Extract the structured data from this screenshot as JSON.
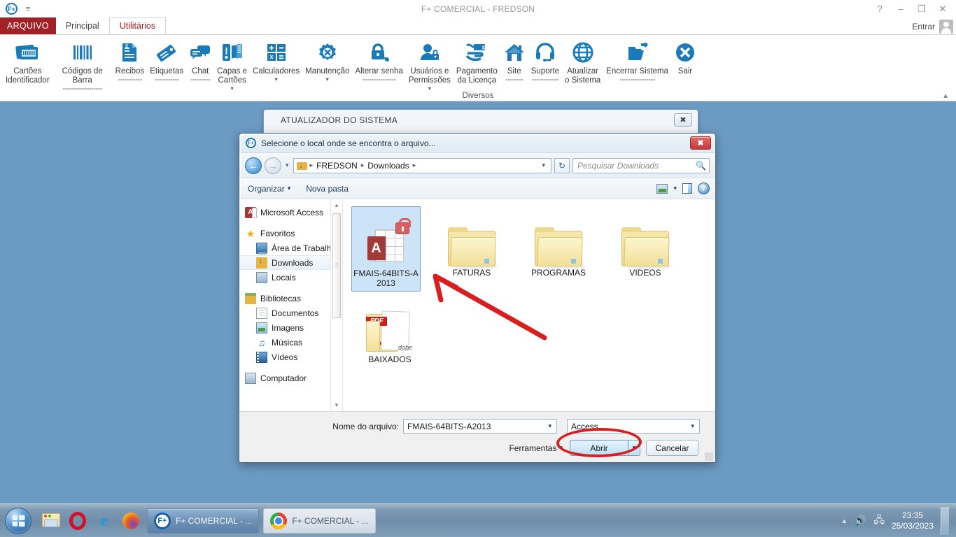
{
  "app": {
    "title": "F+ COMERCIAL - FREDSON",
    "logo": "F+",
    "quick_access_more": "≡",
    "window_controls": [
      {
        "name": "help",
        "glyph": "?"
      },
      {
        "name": "minimize",
        "glyph": "–"
      },
      {
        "name": "restore",
        "glyph": "❐"
      },
      {
        "name": "close",
        "glyph": "✕"
      }
    ],
    "signin_label": "Entrar"
  },
  "tabs": {
    "file_tab": "ARQUIVO",
    "items": [
      {
        "label": "Principal",
        "active": false
      },
      {
        "label": "Utilitários",
        "active": true
      }
    ]
  },
  "ribbon": {
    "group_name": "Diversos",
    "collapse_glyph": "▲",
    "buttons": [
      {
        "label": "Cartões\nIdentificador",
        "icon": "id-card-icon",
        "dash": "",
        "caret": false
      },
      {
        "label": "Códigos de Barra",
        "icon": "barcode-icon",
        "dash": "------------------",
        "caret": false
      },
      {
        "label": "Recibos",
        "icon": "receipt-icon",
        "dash": "-----------",
        "caret": false
      },
      {
        "label": "Etiquetas",
        "icon": "tag-icon",
        "dash": "-----------",
        "caret": false
      },
      {
        "label": "Chat",
        "icon": "chat-icon",
        "dash": "---------",
        "caret": false
      },
      {
        "label": "Capas e\nCartões",
        "icon": "card-cover-icon",
        "dash": "",
        "caret": true
      },
      {
        "label": "Calculadores",
        "icon": "calculator-icon",
        "dash": "",
        "caret": true
      },
      {
        "label": "Manutenção",
        "icon": "maintenance-gear-icon",
        "dash": "",
        "caret": true
      },
      {
        "label": "Alterar senha",
        "icon": "lock-key-icon",
        "dash": "---------------",
        "caret": false
      },
      {
        "label": "Usuários e\nPermissões",
        "icon": "user-lock-icon",
        "dash": "",
        "caret": true
      },
      {
        "label": "Pagamento\nda Licença",
        "icon": "money-hand-icon",
        "dash": "",
        "caret": false
      },
      {
        "label": "Site",
        "icon": "home-icon",
        "dash": "--------",
        "caret": false
      },
      {
        "label": "Suporte",
        "icon": "headset-icon",
        "dash": "------------",
        "caret": false
      },
      {
        "label": "Atualizar\no Sistema",
        "icon": "globe-icon",
        "dash": "",
        "caret": false
      },
      {
        "label": "Encerrar Sistema",
        "icon": "folder-out-icon",
        "dash": "----------------",
        "caret": false
      },
      {
        "label": "Sair",
        "icon": "exit-x-icon",
        "dash": "",
        "caret": false
      }
    ]
  },
  "updater_window": {
    "title": "ATUALIZADOR DO SISTEMA",
    "close_glyph": "✖"
  },
  "dialog": {
    "title": "Selecione o local onde se encontra o arquivo...",
    "logo": "F+",
    "close_glyph": "✖",
    "nav": {
      "back_glyph": "←",
      "forward_glyph": "→",
      "history_caret": "▾",
      "refresh_glyph": "↻"
    },
    "breadcrumb": {
      "items": [
        "FREDSON",
        "Downloads"
      ],
      "separator": "▸",
      "caret": "▾"
    },
    "search": {
      "placeholder": "Pesquisar Downloads",
      "icon": "search-icon"
    },
    "toolbar": {
      "organize": "Organizar",
      "organize_caret": "▾",
      "new_folder": "Nova pasta",
      "view_caret": "▾",
      "help_glyph": "?"
    },
    "navpane": {
      "items": [
        {
          "label": "Microsoft Access",
          "icon": "access-icon",
          "indent": false,
          "selected": false,
          "spacer_before": false
        },
        {
          "label": "Favoritos",
          "icon": "star-icon",
          "indent": false,
          "selected": false,
          "spacer_before": true
        },
        {
          "label": "Área de Trabalho",
          "icon": "desktop-icon",
          "indent": true,
          "selected": false,
          "spacer_before": false
        },
        {
          "label": "Downloads",
          "icon": "downloads-icon",
          "indent": true,
          "selected": true,
          "spacer_before": false
        },
        {
          "label": "Locais",
          "icon": "places-icon",
          "indent": true,
          "selected": false,
          "spacer_before": false
        },
        {
          "label": "Bibliotecas",
          "icon": "libraries-icon",
          "indent": false,
          "selected": false,
          "spacer_before": true
        },
        {
          "label": "Documentos",
          "icon": "documents-icon",
          "indent": true,
          "selected": false,
          "spacer_before": false
        },
        {
          "label": "Imagens",
          "icon": "pictures-icon",
          "indent": true,
          "selected": false,
          "spacer_before": false
        },
        {
          "label": "Músicas",
          "icon": "music-icon",
          "indent": true,
          "selected": false,
          "spacer_before": false
        },
        {
          "label": "Vídeos",
          "icon": "videos-icon",
          "indent": true,
          "selected": false,
          "spacer_before": false
        },
        {
          "label": "Computador",
          "icon": "computer-icon",
          "indent": false,
          "selected": false,
          "spacer_before": true
        }
      ],
      "scroll_up": "▲",
      "scroll_down": "▼"
    },
    "files": {
      "row1": [
        {
          "name": "FMAIS-64BITS-A2013",
          "type": "access-locked",
          "selected": true
        },
        {
          "name": "FATURAS",
          "type": "folder",
          "selected": false
        },
        {
          "name": "PROGRAMAS",
          "type": "folder",
          "selected": false
        },
        {
          "name": "VIDEOS",
          "type": "folder",
          "selected": false
        }
      ],
      "row2": [
        {
          "name": "BAIXADOS",
          "type": "pdf-folder",
          "selected": false
        }
      ]
    },
    "footer": {
      "filename_label": "Nome do arquivo:",
      "filename_value": "FMAIS-64BITS-A2013",
      "filetype_value": "Access",
      "tools_label": "Ferramentas",
      "tools_caret": "▾",
      "open_label": "Abrir",
      "open_caret": "▾",
      "cancel_label": "Cancelar"
    }
  },
  "annotations": {
    "arrow_color": "#d81f1f",
    "ellipse_color": "#d81f1f"
  },
  "taskbar": {
    "start_name": "start-orb",
    "quick_launch": [
      {
        "name": "explorer-icon"
      },
      {
        "name": "opera-icon"
      },
      {
        "name": "internet-explorer-icon"
      },
      {
        "name": "firefox-icon"
      }
    ],
    "tasks": [
      {
        "label": "F+ COMERCIAL - ...",
        "icon": "fplus-icon",
        "active": true
      },
      {
        "label": "F+ COMERCIAL - ...",
        "icon": "chrome-icon",
        "active": false
      }
    ],
    "tray": {
      "expand_glyph": "▲",
      "volume_glyph": "🔊",
      "network_glyph": "🖧",
      "time": "23:35",
      "date": "25/03/2023"
    }
  },
  "colors": {
    "desktop": "#6b9bc3",
    "ribbon_accent": "#1b7bb8",
    "file_tab": "#a02128",
    "active_tab_text": "#a02128"
  }
}
